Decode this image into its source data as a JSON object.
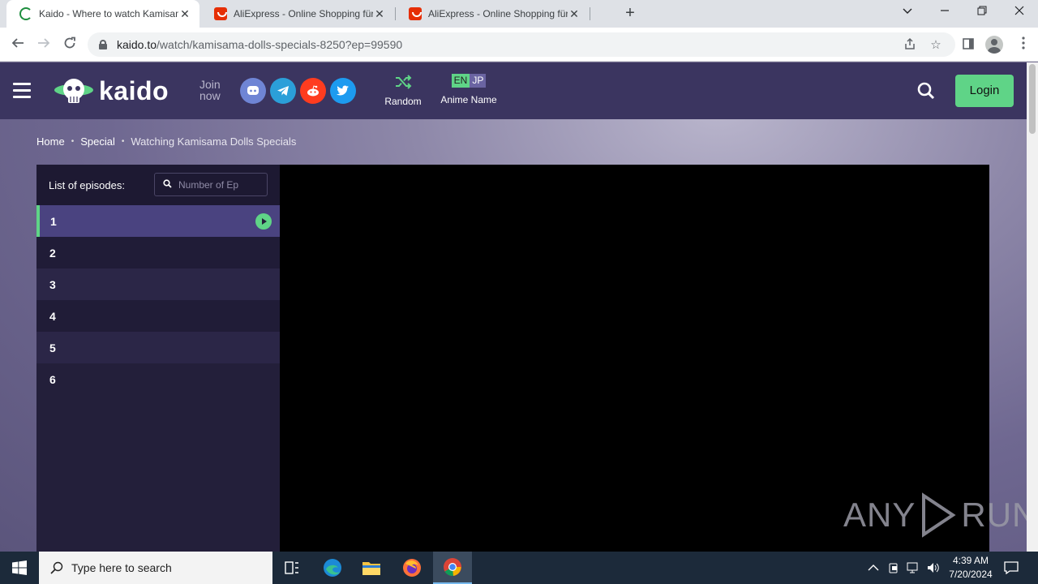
{
  "browser": {
    "tabs": [
      {
        "title": "Kaido - Where to watch Kamisama Dolls Specials",
        "active": true
      },
      {
        "title": "AliExpress - Online Shopping für",
        "active": false
      },
      {
        "title": "AliExpress - Online Shopping für",
        "active": false
      }
    ],
    "new_tab": "+",
    "url_host": "kaido.to",
    "url_path": "/watch/kamisama-dolls-specials-8250?ep=99590"
  },
  "site": {
    "logo_text": "kaido",
    "join_line1": "Join",
    "join_line2": "now",
    "social": [
      "discord-icon",
      "telegram-icon",
      "reddit-icon",
      "twitter-icon"
    ],
    "social_colors": [
      "#6f85d5",
      "#2b9fd9",
      "#ff3c1f",
      "#1d9bf0"
    ],
    "random_label": "Random",
    "lang_en": "EN",
    "lang_jp": "JP",
    "anime_name_label": "Anime Name",
    "login_label": "Login"
  },
  "breadcrumb": {
    "home": "Home",
    "type": "Special",
    "current": "Watching Kamisama Dolls Specials"
  },
  "episodes": {
    "header": "List of episodes:",
    "search_placeholder": "Number of Ep",
    "items": [
      "1",
      "2",
      "3",
      "4",
      "5",
      "6"
    ],
    "active_index": 0
  },
  "watermark": {
    "left": "ANY",
    "right": "RUN"
  },
  "taskbar": {
    "search_placeholder": "Type here to search",
    "time": "4:39 AM",
    "date": "7/20/2024"
  },
  "colors": {
    "accent": "#5fd487",
    "header_bg": "#3b3560",
    "panel_bg": "#231f3a"
  }
}
